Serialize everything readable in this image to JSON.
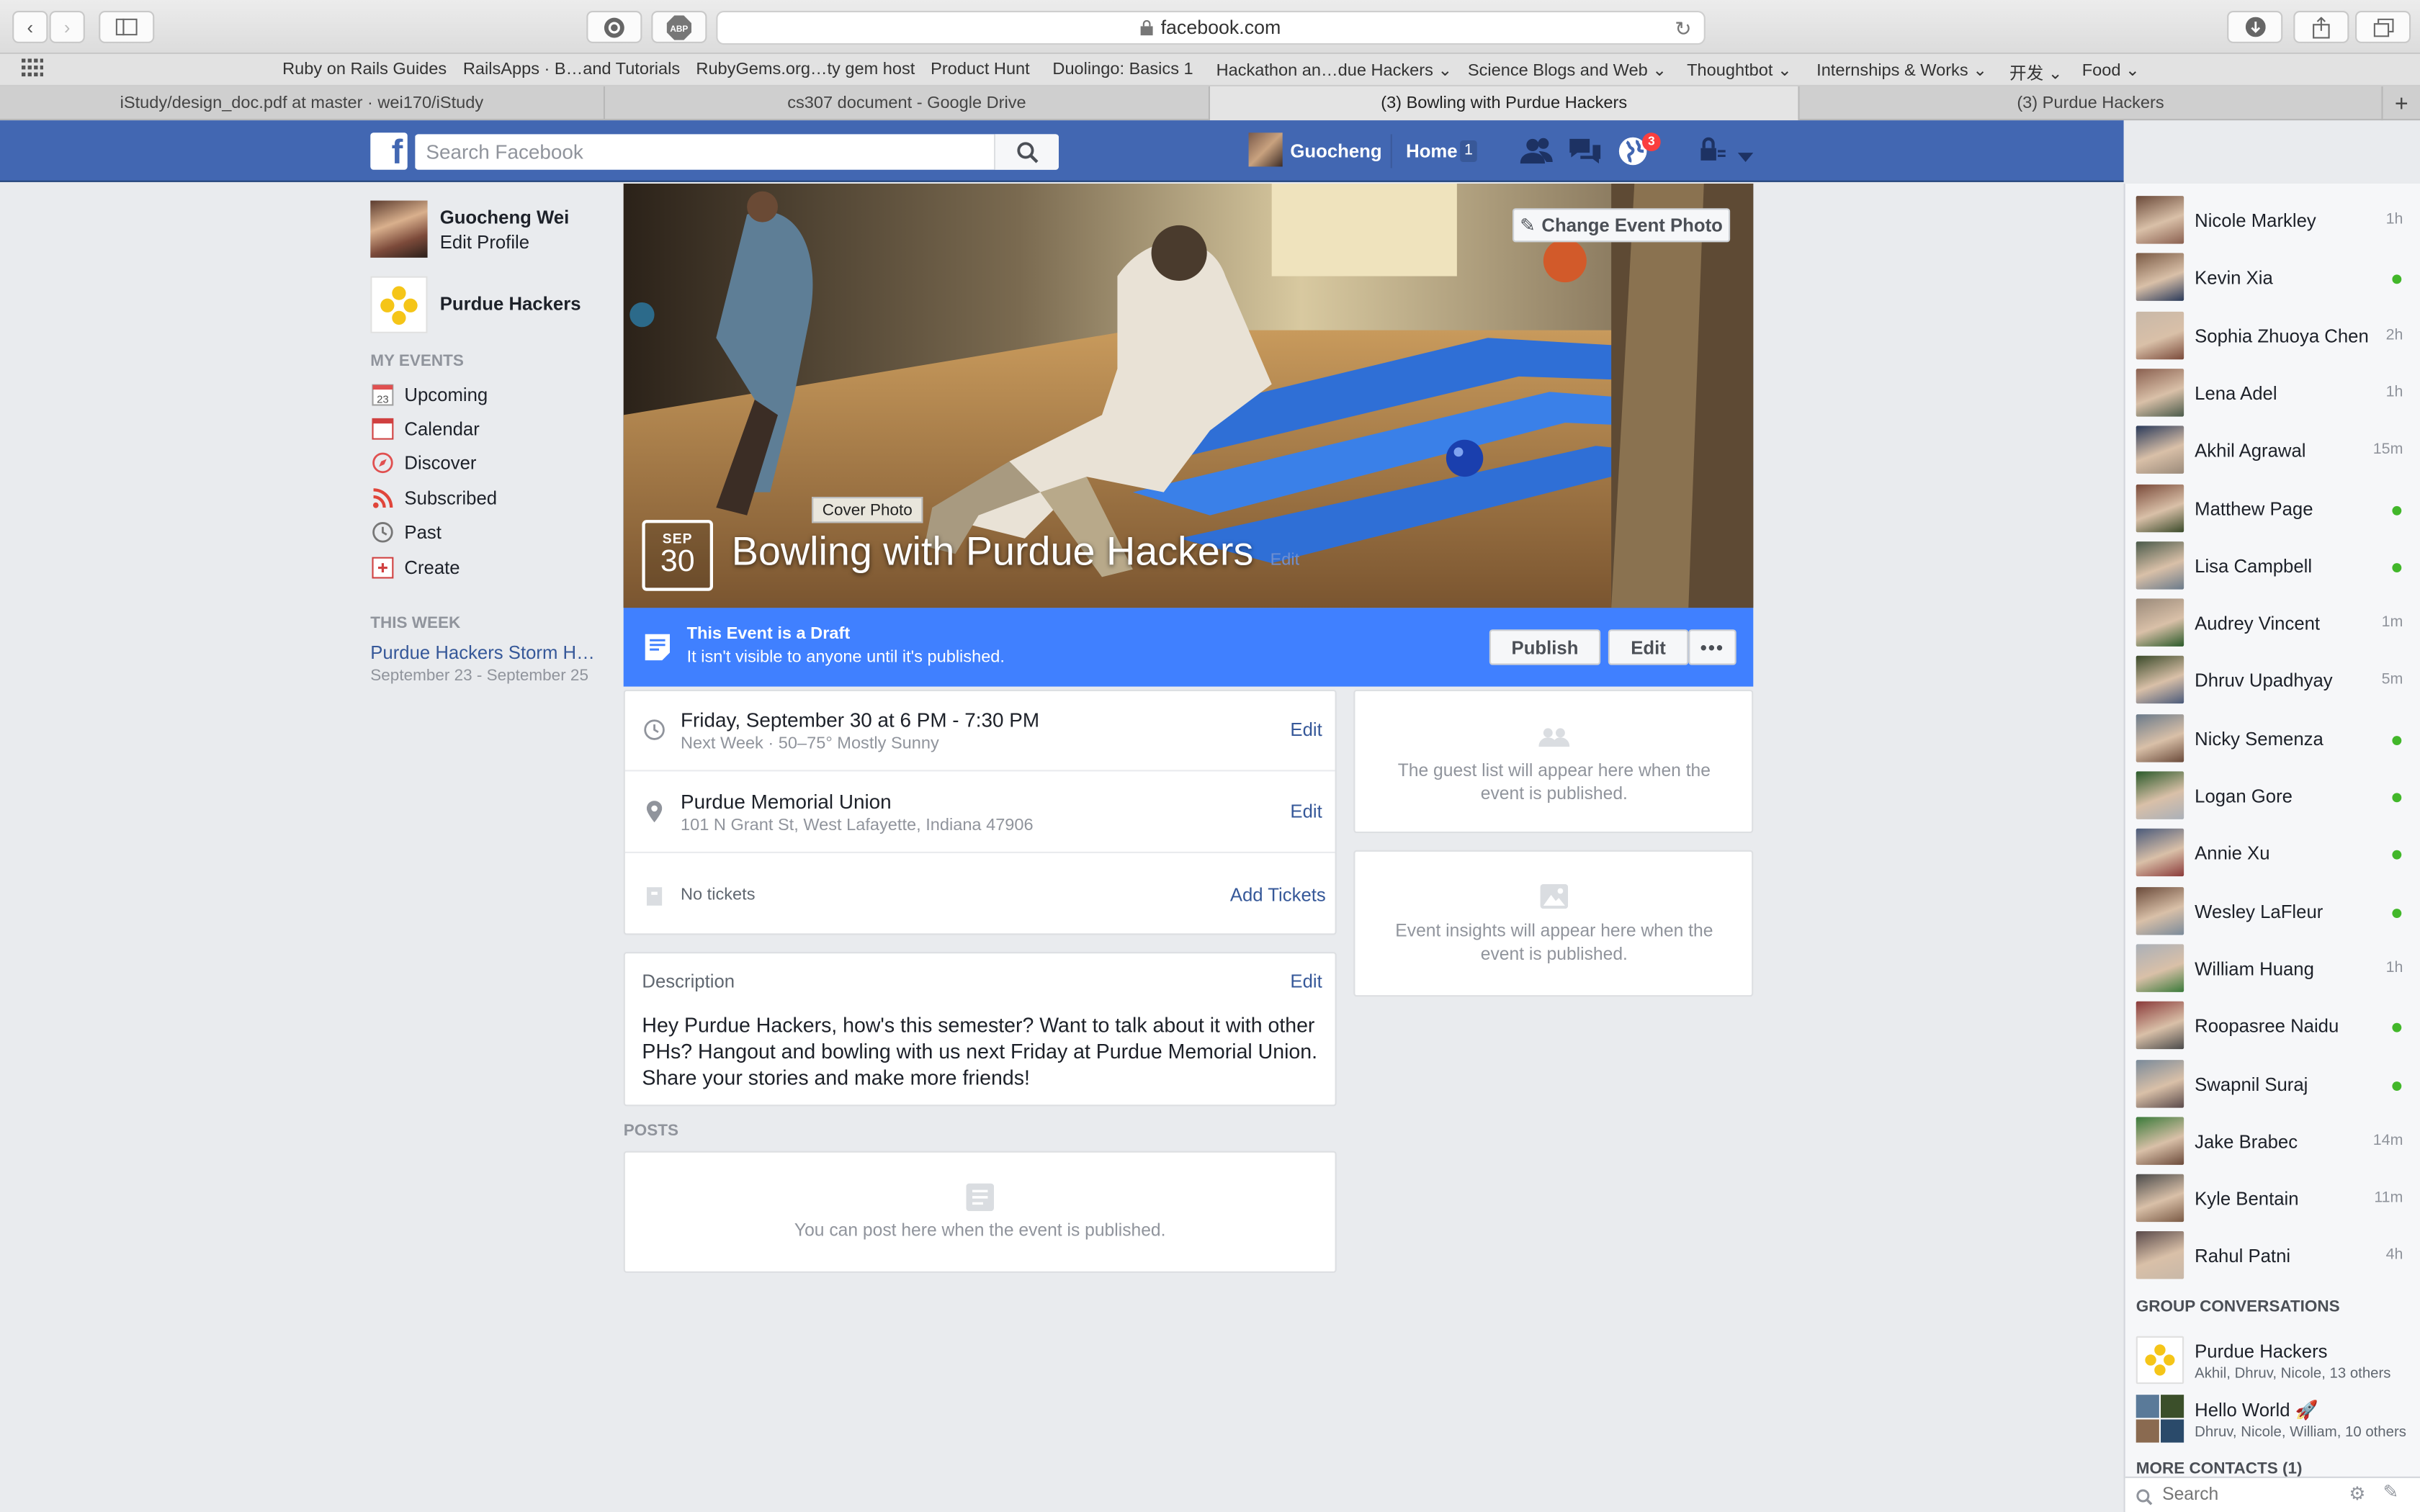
{
  "browser": {
    "url": "facebook.com",
    "bookmarks": [
      "Ruby on Rails Guides",
      "RailsApps · B…and Tutorials",
      "RubyGems.org…ty gem host",
      "Product Hunt",
      "Duolingo: Basics 1",
      "Hackathon an…due Hackers",
      "Science Blogs and Web",
      "Thoughtbot",
      "Internships & Works",
      "开发",
      "Food"
    ],
    "tabs": [
      "iStudy/design_doc.pdf at master · wei170/iStudy",
      "cs307 document - Google Drive",
      "(3) Bowling with Purdue Hackers",
      "(3) Purdue Hackers"
    ]
  },
  "header": {
    "search_placeholder": "Search Facebook",
    "user_name": "Guocheng",
    "home_label": "Home",
    "home_count": "1",
    "notification_count": "3"
  },
  "left": {
    "profile_name": "Guocheng Wei",
    "edit_profile": "Edit Profile",
    "group_name": "Purdue Hackers",
    "my_events_heading": "MY EVENTS",
    "nav": [
      "Upcoming",
      "Calendar",
      "Discover",
      "Subscribed",
      "Past",
      "Create"
    ],
    "calendar_icon_day": "23",
    "this_week_heading": "THIS WEEK",
    "week_event_title": "Purdue Hackers Storm H…",
    "week_event_dates": "September 23 - September 25"
  },
  "event": {
    "change_photo": "Change Event Photo",
    "cover_tooltip": "Cover Photo",
    "month": "SEP",
    "day": "30",
    "title": "Bowling with Purdue Hackers",
    "title_edit": "Edit",
    "draft_title": "This Event is a Draft",
    "draft_subtitle": "It isn't visible to anyone until it's published.",
    "publish": "Publish",
    "edit": "Edit",
    "more": "•••",
    "datetime": "Friday, September 30 at 6 PM - 7:30 PM",
    "weather": "Next Week · 50–75° Mostly Sunny",
    "location_name": "Purdue Memorial Union",
    "location_address": "101 N Grant St, West Lafayette, Indiana 47906",
    "tickets": "No tickets",
    "add_tickets": "Add Tickets",
    "row_edit": "Edit",
    "description_heading": "Description",
    "description": "Hey Purdue Hackers, how's this semester? Want to talk about it with other PHs? Hangout and bowling with us next Friday at Purdue Memorial Union. Share your stories and make more friends!",
    "posts_heading": "POSTS",
    "posts_placeholder": "You can post here when the event is published.",
    "guest_placeholder": "The guest list will appear here when the event is published.",
    "insights_placeholder": "Event insights will appear here when the event is published."
  },
  "chat": {
    "contacts": [
      {
        "name": "Nicole Markley",
        "status": "1h"
      },
      {
        "name": "Kevin Xia",
        "status": "online"
      },
      {
        "name": "Sophia Zhuoya Chen",
        "status": "2h"
      },
      {
        "name": "Lena Adel",
        "status": "1h"
      },
      {
        "name": "Akhil Agrawal",
        "status": "15m"
      },
      {
        "name": "Matthew Page",
        "status": "online"
      },
      {
        "name": "Lisa Campbell",
        "status": "online"
      },
      {
        "name": "Audrey Vincent",
        "status": "1m"
      },
      {
        "name": "Dhruv Upadhyay",
        "status": "5m"
      },
      {
        "name": "Nicky Semenza",
        "status": "online"
      },
      {
        "name": "Logan Gore",
        "status": "online"
      },
      {
        "name": "Annie Xu",
        "status": "online"
      },
      {
        "name": "Wesley LaFleur",
        "status": "online"
      },
      {
        "name": "William Huang",
        "status": "1h"
      },
      {
        "name": "Roopasree Naidu",
        "status": "online"
      },
      {
        "name": "Swapnil Suraj",
        "status": "online"
      },
      {
        "name": "Jake Brabec",
        "status": "14m"
      },
      {
        "name": "Kyle Bentain",
        "status": "11m"
      },
      {
        "name": "Rahul Patni",
        "status": "4h"
      }
    ],
    "group_heading": "GROUP CONVERSATIONS",
    "groups": [
      {
        "name": "Purdue Hackers",
        "members": "Akhil, Dhruv, Nicole, 13 others"
      },
      {
        "name": "Hello World",
        "members": "Dhruv, Nicole, William, 10 others"
      }
    ],
    "more_contacts": "MORE CONTACTS (1)",
    "search_placeholder": "Search"
  },
  "colors": {
    "fb_blue": "#4267b2",
    "draft_blue": "#4080ff",
    "online_green": "#42b72a",
    "badge_red": "#fa3e3e"
  }
}
